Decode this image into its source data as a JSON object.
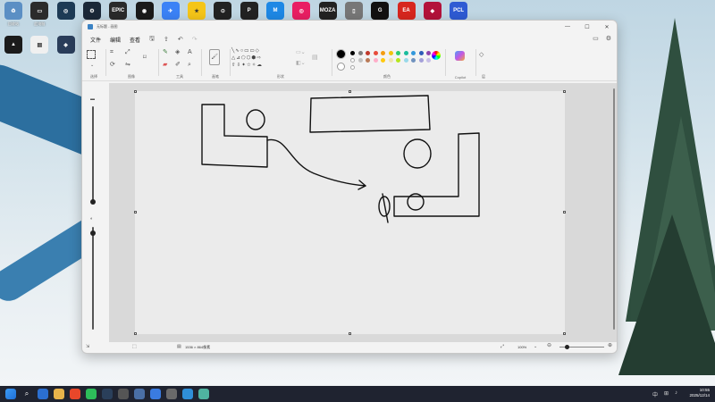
{
  "window": {
    "title": "无标题 - 画图"
  },
  "menu": {
    "file": "文件",
    "edit": "编辑",
    "view": "查看"
  },
  "ribbon": {
    "labels": {
      "selection": "选择",
      "image": "图像",
      "tools": "工具",
      "brushes": "画笔",
      "shapes": "形状",
      "colors": "颜色",
      "copilot": "Copilot",
      "layers": "层"
    },
    "colors_row1": [
      "#000000",
      "#7f7f7f",
      "#c0392b",
      "#e74c3c",
      "#f39c12",
      "#f1c40f",
      "#2ecc71",
      "#1abc9c",
      "#3498db",
      "#2e5cb8",
      "#8e44ad"
    ],
    "colors_row2": [
      "#ffffff",
      "#c3c3c3",
      "#b97a57",
      "#ffaec9",
      "#ffc90e",
      "#efe4b0",
      "#b5e61d",
      "#99d9ea",
      "#7092be",
      "#a4a0d9",
      "#c8bfe7"
    ],
    "current_color": "#000000"
  },
  "status": {
    "dimensions": "1536 × 864像素",
    "zoom": "100%"
  },
  "tray": {
    "time": "10:55",
    "date": "2025/12/14",
    "lang": "中"
  },
  "desktop_icons": [
    {
      "label": "回收站",
      "color": "#5b8fc4",
      "text": "♻"
    },
    {
      "label": "此电脑",
      "color": "#2b2b2b",
      "text": "▭"
    },
    {
      "label": "",
      "color": "#1d3a55",
      "text": "◎"
    },
    {
      "label": "",
      "color": "#1b2838",
      "text": "⚙"
    },
    {
      "label": "",
      "color": "#2a2a2a",
      "text": "EPIC"
    },
    {
      "label": "",
      "color": "#1a1a1a",
      "text": "◉"
    },
    {
      "label": "",
      "color": "#3b82f6",
      "text": "✈"
    },
    {
      "label": "",
      "color": "#f5c518",
      "text": "★"
    },
    {
      "label": "",
      "color": "#222",
      "text": "⊙"
    },
    {
      "label": "",
      "color": "#222",
      "text": "P"
    },
    {
      "label": "",
      "color": "#1e88e5",
      "text": "M"
    },
    {
      "label": "",
      "color": "#e91e63",
      "text": "◎"
    },
    {
      "label": "",
      "color": "#222",
      "text": "MOZA"
    },
    {
      "label": "",
      "color": "#777",
      "text": "▯"
    },
    {
      "label": "",
      "color": "#111",
      "text": "G"
    },
    {
      "label": "",
      "color": "#d7261e",
      "text": "EA"
    },
    {
      "label": "",
      "color": "#b3123a",
      "text": "◆"
    },
    {
      "label": "",
      "color": "#2f5bd3",
      "text": "PCL"
    }
  ],
  "desktop_icons_row2": [
    {
      "label": "",
      "color": "#1b1b1b",
      "text": "▲"
    },
    {
      "label": "",
      "color": "#f0f0f0",
      "text": "▤"
    },
    {
      "label": "",
      "color": "#2a3d5a",
      "text": "◈"
    }
  ]
}
